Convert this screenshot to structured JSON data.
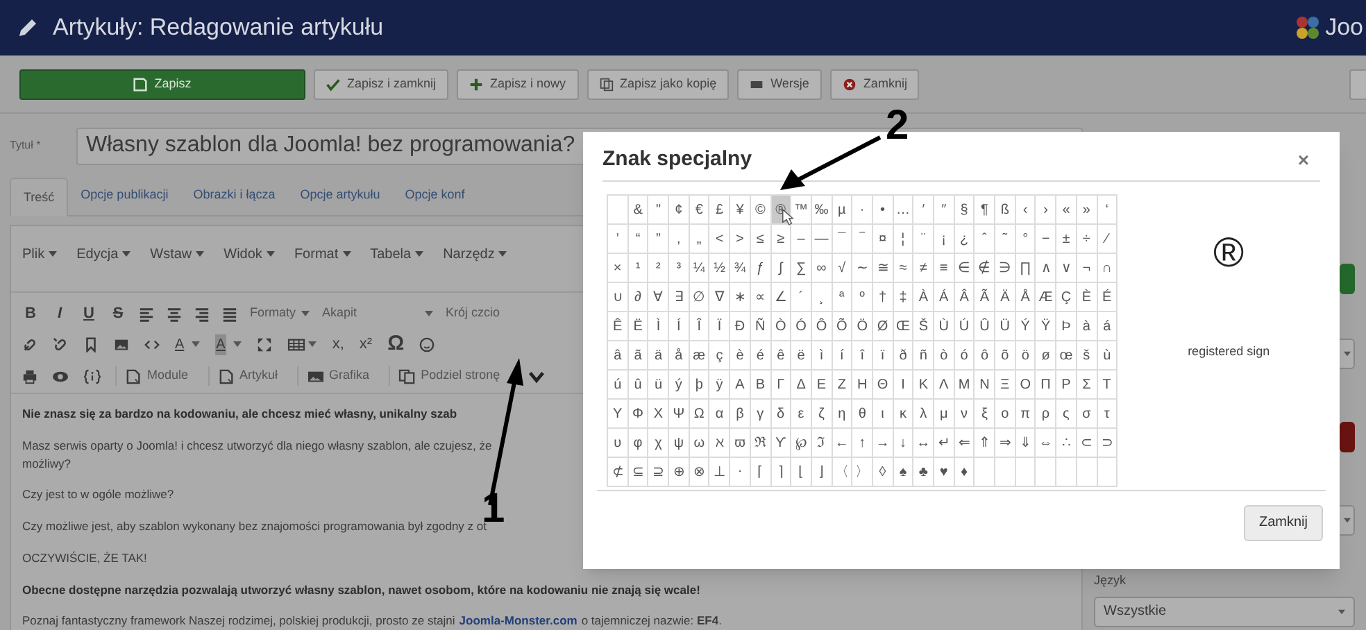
{
  "header": {
    "title": "Artykuły: Redagowanie artykułu",
    "logo_text": "Joo"
  },
  "toolbar": [
    {
      "label": "Zapisz",
      "kind": "save"
    },
    {
      "label": "Zapisz i zamknij",
      "kind": "save-close"
    },
    {
      "label": "Zapisz i nowy",
      "kind": "save-new"
    },
    {
      "label": "Zapisz jako kopię",
      "kind": "save-copy"
    },
    {
      "label": "Wersje",
      "kind": "versions"
    },
    {
      "label": "Zamknij",
      "kind": "close"
    }
  ],
  "title_field": {
    "label": "Tytuł *",
    "value": "Własny szablon dla Joomla! bez programowania?"
  },
  "tabs": [
    {
      "label": "Treść",
      "selected": true
    },
    {
      "label": "Opcje publikacji",
      "selected": false
    },
    {
      "label": "Obrazki i łącza",
      "selected": false
    },
    {
      "label": "Opcje artykułu",
      "selected": false
    },
    {
      "label": "Opcje konf",
      "selected": false
    }
  ],
  "editor": {
    "menu": [
      "Plik",
      "Edycja",
      "Wstaw",
      "Widok",
      "Format",
      "Tabela",
      "Narzędz"
    ],
    "format_buttons": [
      {
        "label": "B",
        "kind": "bold"
      },
      {
        "label": "I",
        "kind": "italic"
      },
      {
        "label": "U",
        "kind": "underline"
      },
      {
        "label": "S",
        "kind": "strike"
      }
    ],
    "dropdowns": [
      "Formaty",
      "Akapit",
      "Krój czcio"
    ],
    "color_buttons": [
      {
        "label": "A",
        "kind": "text-color"
      },
      {
        "label": "A",
        "kind": "background-color"
      }
    ],
    "symbol_buttons": [
      "x,",
      "x²",
      "Ω"
    ],
    "insert_buttons": [
      "Module",
      "Artykuł",
      "Grafika",
      "Podziel stronę"
    ],
    "paragraphs": [
      {
        "kind": "bold",
        "lines": [
          "Nie znasz się za bardzo na kodowaniu, ale chcesz mieć własny, unikalny szab"
        ]
      },
      {
        "kind": "normal",
        "lines": [
          "Masz serwis oparty o Joomla! i chcesz utworzyć dla niego własny szablon, ale czujesz, że",
          "możliwy?"
        ]
      },
      {
        "kind": "normal",
        "lines": [
          "Czy jest to w ogóle możliwe?"
        ]
      },
      {
        "kind": "normal",
        "lines": [
          "Czy możliwe jest, aby szablon wykonany bez znajomości programowania był zgodny z ot"
        ]
      },
      {
        "kind": "normal",
        "lines": [
          "OCZYWIŚCIE, ŻE TAK!"
        ]
      },
      {
        "kind": "bold",
        "lines": [
          "Obecne dostępne narzędzia pozwalają utworzyć własny szablon, nawet osobom, które na kodowaniu nie znają się wcale!"
        ]
      },
      {
        "kind": "link",
        "before": "Poznaj fantastyczny framework Naszej rodzimej, polskiej produkcji, prosto ze stajni",
        "link": "Joomla-Monster.com",
        "after": "o tajemniczej nazwie: **EF4**."
      }
    ]
  },
  "sidebar": {
    "language_label": "Język",
    "language_value": "Wszystkie"
  },
  "dialog": {
    "title": "Znak specjalny",
    "close": "×",
    "rows": [
      {
        "cells": [
          {
            "selected": false
          },
          {
            "char": "&",
            "selected": false
          },
          {
            "char": "\"",
            "selected": false
          },
          {
            "char": "¢",
            "selected": false
          },
          {
            "char": "€",
            "selected": false
          },
          {
            "char": "£",
            "selected": false
          },
          {
            "char": "¥",
            "selected": false
          },
          {
            "char": "©",
            "selected": false
          },
          {
            "char": "®",
            "selected": true
          },
          {
            "char": "™",
            "selected": false
          },
          {
            "char": "‰",
            "selected": false
          },
          {
            "char": "µ",
            "selected": false
          },
          {
            "char": "·",
            "selected": false
          },
          {
            "char": "•",
            "selected": false
          },
          {
            "char": "…",
            "selected": false
          },
          {
            "char": "′",
            "selected": false
          },
          {
            "char": "″",
            "selected": false
          },
          {
            "char": "§",
            "selected": false
          },
          {
            "char": "¶",
            "selected": false
          },
          {
            "char": "ß",
            "selected": false
          },
          {
            "char": "‹",
            "selected": false
          },
          {
            "char": "›",
            "selected": false
          },
          {
            "char": "«",
            "selected": false
          },
          {
            "char": "»",
            "selected": false
          },
          {
            "char": "‘",
            "selected": false
          }
        ]
      },
      {
        "cells": [
          {
            "char": "’",
            "selected": false
          },
          {
            "char": "“",
            "selected": false
          },
          {
            "char": "”",
            "selected": false
          },
          {
            "char": "‚",
            "selected": false
          },
          {
            "char": "„",
            "selected": false
          },
          {
            "char": "<",
            "selected": false
          },
          {
            "char": ">",
            "selected": false
          },
          {
            "char": "≤",
            "selected": false
          },
          {
            "char": "≥",
            "selected": false
          },
          {
            "char": "–",
            "selected": false
          },
          {
            "char": "—",
            "selected": false
          },
          {
            "char": "¯",
            "selected": false
          },
          {
            "char": "‾",
            "selected": false
          },
          {
            "char": "¤",
            "selected": false
          },
          {
            "char": "¦",
            "selected": false
          },
          {
            "char": "¨",
            "selected": false
          },
          {
            "char": "¡",
            "selected": false
          },
          {
            "char": "¿",
            "selected": false
          },
          {
            "char": "ˆ",
            "selected": false
          },
          {
            "char": "˜",
            "selected": false
          },
          {
            "char": "°",
            "selected": false
          },
          {
            "char": "−",
            "selected": false
          },
          {
            "char": "±",
            "selected": false
          },
          {
            "char": "÷",
            "selected": false
          },
          {
            "char": "⁄",
            "selected": false
          }
        ]
      },
      {
        "cells": [
          {
            "char": "×",
            "selected": false
          },
          {
            "char": "¹",
            "selected": false
          },
          {
            "char": "²",
            "selected": false
          },
          {
            "char": "³",
            "selected": false
          },
          {
            "char": "¼",
            "selected": false
          },
          {
            "char": "½",
            "selected": false
          },
          {
            "char": "¾",
            "selected": false
          },
          {
            "char": "ƒ",
            "selected": false
          },
          {
            "char": "∫",
            "selected": false
          },
          {
            "char": "∑",
            "selected": false
          },
          {
            "char": "∞",
            "selected": false
          },
          {
            "char": "√",
            "selected": false
          },
          {
            "char": "∼",
            "selected": false
          },
          {
            "char": "≅",
            "selected": false
          },
          {
            "char": "≈",
            "selected": false
          },
          {
            "char": "≠",
            "selected": false
          },
          {
            "char": "≡",
            "selected": false
          },
          {
            "char": "∈",
            "selected": false
          },
          {
            "char": "∉",
            "selected": false
          },
          {
            "char": "∋",
            "selected": false
          },
          {
            "char": "∏",
            "selected": false
          },
          {
            "char": "∧",
            "selected": false
          },
          {
            "char": "∨",
            "selected": false
          },
          {
            "char": "¬",
            "selected": false
          },
          {
            "char": "∩",
            "selected": false
          }
        ]
      },
      {
        "cells": [
          {
            "char": "∪",
            "selected": false
          },
          {
            "char": "∂",
            "selected": false
          },
          {
            "char": "∀",
            "selected": false
          },
          {
            "char": "∃",
            "selected": false
          },
          {
            "char": "∅",
            "selected": false
          },
          {
            "char": "∇",
            "selected": false
          },
          {
            "char": "∗",
            "selected": false
          },
          {
            "char": "∝",
            "selected": false
          },
          {
            "char": "∠",
            "selected": false
          },
          {
            "char": "´",
            "selected": false
          },
          {
            "char": "¸",
            "selected": false
          },
          {
            "char": "ª",
            "selected": false
          },
          {
            "char": "º",
            "selected": false
          },
          {
            "char": "†",
            "selected": false
          },
          {
            "char": "‡",
            "selected": false
          },
          {
            "char": "À",
            "selected": false
          },
          {
            "char": "Á",
            "selected": false
          },
          {
            "char": "Â",
            "selected": false
          },
          {
            "char": "Ã",
            "selected": false
          },
          {
            "char": "Ä",
            "selected": false
          },
          {
            "char": "Å",
            "selected": false
          },
          {
            "char": "Æ",
            "selected": false
          },
          {
            "char": "Ç",
            "selected": false
          },
          {
            "char": "È",
            "selected": false
          },
          {
            "char": "É",
            "selected": false
          }
        ]
      },
      {
        "cells": [
          {
            "char": "Ê",
            "selected": false
          },
          {
            "char": "Ë",
            "selected": false
          },
          {
            "char": "Ì",
            "selected": false
          },
          {
            "char": "Í",
            "selected": false
          },
          {
            "char": "Î",
            "selected": false
          },
          {
            "char": "Ï",
            "selected": false
          },
          {
            "char": "Ð",
            "selected": false
          },
          {
            "char": "Ñ",
            "selected": false
          },
          {
            "char": "Ò",
            "selected": false
          },
          {
            "char": "Ó",
            "selected": false
          },
          {
            "char": "Ô",
            "selected": false
          },
          {
            "char": "Õ",
            "selected": false
          },
          {
            "char": "Ö",
            "selected": false
          },
          {
            "char": "Ø",
            "selected": false
          },
          {
            "char": "Œ",
            "selected": false
          },
          {
            "char": "Š",
            "selected": false
          },
          {
            "char": "Ù",
            "selected": false
          },
          {
            "char": "Ú",
            "selected": false
          },
          {
            "char": "Û",
            "selected": false
          },
          {
            "char": "Ü",
            "selected": false
          },
          {
            "char": "Ý",
            "selected": false
          },
          {
            "char": "Ÿ",
            "selected": false
          },
          {
            "char": "Þ",
            "selected": false
          },
          {
            "char": "à",
            "selected": false
          },
          {
            "char": "á",
            "selected": false
          }
        ]
      },
      {
        "cells": [
          {
            "char": "â",
            "selected": false
          },
          {
            "char": "ã",
            "selected": false
          },
          {
            "char": "ä",
            "selected": false
          },
          {
            "char": "å",
            "selected": false
          },
          {
            "char": "æ",
            "selected": false
          },
          {
            "char": "ç",
            "selected": false
          },
          {
            "char": "è",
            "selected": false
          },
          {
            "char": "é",
            "selected": false
          },
          {
            "char": "ê",
            "selected": false
          },
          {
            "char": "ë",
            "selected": false
          },
          {
            "char": "ì",
            "selected": false
          },
          {
            "char": "í",
            "selected": false
          },
          {
            "char": "î",
            "selected": false
          },
          {
            "char": "ï",
            "selected": false
          },
          {
            "char": "ð",
            "selected": false
          },
          {
            "char": "ñ",
            "selected": false
          },
          {
            "char": "ò",
            "selected": false
          },
          {
            "char": "ó",
            "selected": false
          },
          {
            "char": "ô",
            "selected": false
          },
          {
            "char": "õ",
            "selected": false
          },
          {
            "char": "ö",
            "selected": false
          },
          {
            "char": "ø",
            "selected": false
          },
          {
            "char": "œ",
            "selected": false
          },
          {
            "char": "š",
            "selected": false
          },
          {
            "char": "ù",
            "selected": false
          }
        ]
      },
      {
        "cells": [
          {
            "char": "ú",
            "selected": false
          },
          {
            "char": "û",
            "selected": false
          },
          {
            "char": "ü",
            "selected": false
          },
          {
            "char": "ý",
            "selected": false
          },
          {
            "char": "þ",
            "selected": false
          },
          {
            "char": "ÿ",
            "selected": false
          },
          {
            "char": "Α",
            "selected": false
          },
          {
            "char": "Β",
            "selected": false
          },
          {
            "char": "Γ",
            "selected": false
          },
          {
            "char": "Δ",
            "selected": false
          },
          {
            "char": "Ε",
            "selected": false
          },
          {
            "char": "Ζ",
            "selected": false
          },
          {
            "char": "Η",
            "selected": false
          },
          {
            "char": "Θ",
            "selected": false
          },
          {
            "char": "Ι",
            "selected": false
          },
          {
            "char": "Κ",
            "selected": false
          },
          {
            "char": "Λ",
            "selected": false
          },
          {
            "char": "Μ",
            "selected": false
          },
          {
            "char": "Ν",
            "selected": false
          },
          {
            "char": "Ξ",
            "selected": false
          },
          {
            "char": "Ο",
            "selected": false
          },
          {
            "char": "Π",
            "selected": false
          },
          {
            "char": "Ρ",
            "selected": false
          },
          {
            "char": "Σ",
            "selected": false
          },
          {
            "char": "Τ",
            "selected": false
          }
        ]
      },
      {
        "cells": [
          {
            "char": "Υ",
            "selected": false
          },
          {
            "char": "Φ",
            "selected": false
          },
          {
            "char": "Χ",
            "selected": false
          },
          {
            "char": "Ψ",
            "selected": false
          },
          {
            "char": "Ω",
            "selected": false
          },
          {
            "char": "α",
            "selected": false
          },
          {
            "char": "β",
            "selected": false
          },
          {
            "char": "γ",
            "selected": false
          },
          {
            "char": "δ",
            "selected": false
          },
          {
            "char": "ε",
            "selected": false
          },
          {
            "char": "ζ",
            "selected": false
          },
          {
            "char": "η",
            "selected": false
          },
          {
            "char": "θ",
            "selected": false
          },
          {
            "char": "ι",
            "selected": false
          },
          {
            "char": "κ",
            "selected": false
          },
          {
            "char": "λ",
            "selected": false
          },
          {
            "char": "μ",
            "selected": false
          },
          {
            "char": "ν",
            "selected": false
          },
          {
            "char": "ξ",
            "selected": false
          },
          {
            "char": "ο",
            "selected": false
          },
          {
            "char": "π",
            "selected": false
          },
          {
            "char": "ρ",
            "selected": false
          },
          {
            "char": "ς",
            "selected": false
          },
          {
            "char": "σ",
            "selected": false
          },
          {
            "char": "τ",
            "selected": false
          }
        ]
      },
      {
        "cells": [
          {
            "char": "υ",
            "selected": false
          },
          {
            "char": "φ",
            "selected": false
          },
          {
            "char": "χ",
            "selected": false
          },
          {
            "char": "ψ",
            "selected": false
          },
          {
            "char": "ω",
            "selected": false
          },
          {
            "char": "ℵ",
            "selected": false
          },
          {
            "char": "ϖ",
            "selected": false
          },
          {
            "char": "ℜ",
            "selected": false
          },
          {
            "char": "ϒ",
            "selected": false
          },
          {
            "char": "℘",
            "selected": false
          },
          {
            "char": "ℑ",
            "selected": false
          },
          {
            "char": "←",
            "selected": false
          },
          {
            "char": "↑",
            "selected": false
          },
          {
            "char": "→",
            "selected": false
          },
          {
            "char": "↓",
            "selected": false
          },
          {
            "char": "↔",
            "selected": false
          },
          {
            "char": "↵",
            "selected": false
          },
          {
            "char": "⇐",
            "selected": false
          },
          {
            "char": "⇑",
            "selected": false
          },
          {
            "char": "⇒",
            "selected": false
          },
          {
            "char": "⇓",
            "selected": false
          },
          {
            "char": "⇔",
            "selected": false
          },
          {
            "char": "∴",
            "selected": false
          },
          {
            "char": "⊂",
            "selected": false
          },
          {
            "char": "⊃",
            "selected": false
          }
        ]
      },
      {
        "cells": [
          {
            "char": "⊄",
            "selected": false
          },
          {
            "char": "⊆",
            "selected": false
          },
          {
            "char": "⊇",
            "selected": false
          },
          {
            "char": "⊕",
            "selected": false
          },
          {
            "char": "⊗",
            "selected": false
          },
          {
            "char": "⊥",
            "selected": false
          },
          {
            "char": "⋅",
            "selected": false
          },
          {
            "char": "⌈",
            "selected": false
          },
          {
            "char": "⌉",
            "selected": false
          },
          {
            "char": "⌊",
            "selected": false
          },
          {
            "char": "⌋",
            "selected": false
          },
          {
            "char": "〈",
            "selected": false
          },
          {
            "char": "〉",
            "selected": false
          },
          {
            "char": "◊",
            "selected": false
          },
          {
            "char": "♠",
            "selected": false
          },
          {
            "char": "♣",
            "selected": false
          },
          {
            "char": "♥",
            "selected": false
          },
          {
            "char": "♦",
            "selected": false
          },
          {
            "selected": false
          },
          {
            "selected": false
          },
          {
            "selected": false
          },
          {
            "selected": false
          },
          {
            "selected": false
          },
          {
            "selected": false
          },
          {
            "selected": false
          }
        ]
      }
    ],
    "preview": {
      "char": "®",
      "name": "registered sign"
    },
    "button": "Zamknij"
  },
  "annotations": [
    {
      "label": "1"
    },
    {
      "label": "2"
    }
  ]
}
